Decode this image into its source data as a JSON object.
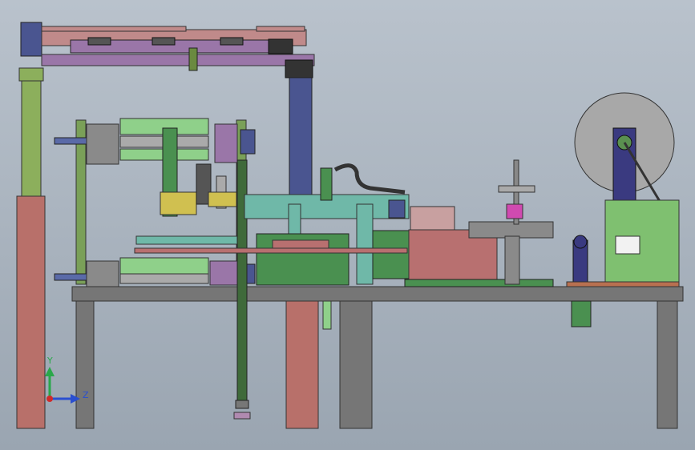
{
  "viewport": {
    "background_top": "#b9c2cc",
    "background_bottom": "#9aa5b1"
  },
  "triad": {
    "y_label": "Y",
    "z_label": "Z",
    "y_color": "#2aa84a",
    "z_color": "#2a4fd0",
    "origin_color": "#d02a2a"
  },
  "colors": {
    "frame_grey": "#767676",
    "leg_pink": "#b8706a",
    "column_green": "#8caf5c",
    "column_blue": "#4a5590",
    "beam_pink": "#c08a8a",
    "rail_purple": "#9a76a8",
    "roller_green": "#8fd08a",
    "plate_teal": "#6fb8a8",
    "body_pink": "#b87070",
    "panel_green": "#7fc070",
    "reel_grey": "#a8a8a8",
    "arm_navy": "#3a3a80",
    "cylinder_blue": "#5a6aa8",
    "block_yellow": "#d0c050"
  }
}
